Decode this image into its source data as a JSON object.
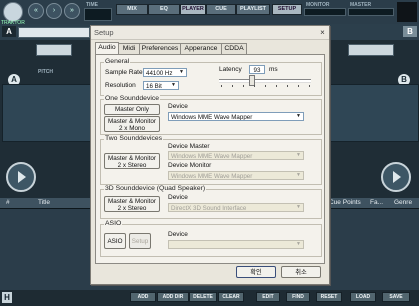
{
  "app": {
    "logo_text": "TRAKTOR",
    "time_label": "TIME",
    "menu": [
      "MIX",
      "EQ",
      "PLAYER",
      "CUE",
      "PLAYLIST",
      "SETUP"
    ],
    "monitor_label": "MONITOR",
    "master_label": "MASTER",
    "deck_a": "A",
    "deck_b": "B",
    "pitch_label": "PITCH",
    "list_columns": [
      "#",
      "Title",
      "Cue Points",
      "Fa...",
      "Genre"
    ],
    "bottom_buttons": [
      "ADD",
      "ADD DIR",
      "DELETE",
      "CLEAR",
      "EDIT",
      "FIND",
      "RESET",
      "LOAD",
      "SAVE"
    ],
    "bottom_left": "H"
  },
  "dialog": {
    "title": "Setup",
    "tabs": [
      "Audio",
      "Midi",
      "Preferences",
      "Apperance",
      "CDDA"
    ],
    "general": {
      "title": "General",
      "sample_rate_label": "Sample Rate",
      "sample_rate_value": "44100 Hz",
      "resolution_label": "Resolution",
      "resolution_value": "16 Bit",
      "latency_label": "Latency",
      "latency_value": "93",
      "latency_unit": "ms",
      "latency_level": 0.35
    },
    "one": {
      "title": "One Sounddevice",
      "master_only": "Master Only",
      "master_monitor_l1": "Master & Monitor",
      "master_monitor_l2": "2 x Mono",
      "device_label": "Device",
      "device_value": "Windows MME Wave Mapper"
    },
    "two": {
      "title": "Two Sounddevices",
      "btn_l1": "Master & Monitor",
      "btn_l2": "2 x Stereo",
      "master_label": "Device Master",
      "master_value": "Windows MME Wave Mapper",
      "monitor_label": "Device Monitor",
      "monitor_value": "Windows MME Wave Mapper"
    },
    "three": {
      "title": "3D Sounddevice (Quad Speaker)",
      "btn_l1": "Master & Monitor",
      "btn_l2": "2 x Stereo",
      "device_label": "Device",
      "device_value": "DirectX 3D Sound Interface"
    },
    "asio": {
      "title": "ASIO",
      "asio_btn": "ASIO",
      "setup_btn": "Setup",
      "device_label": "Device",
      "device_value": ""
    },
    "ok": "확인",
    "cancel": "취소",
    "close": "×"
  }
}
